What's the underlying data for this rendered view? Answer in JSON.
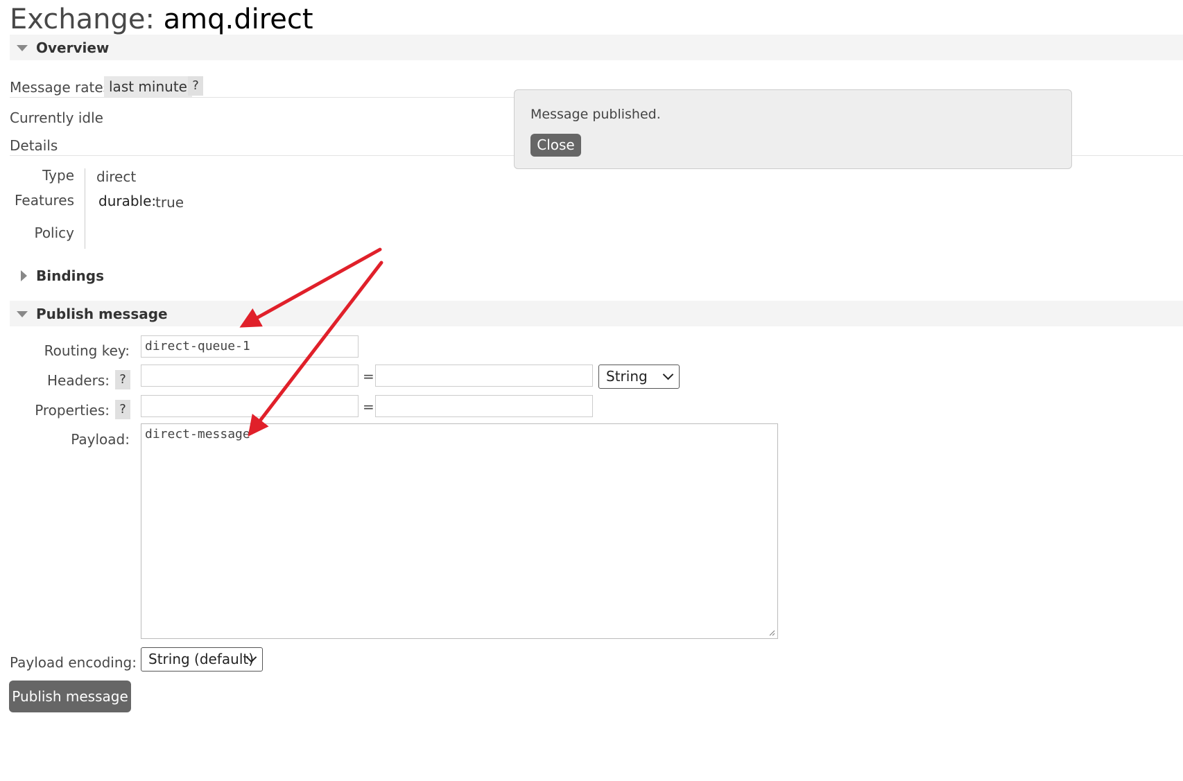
{
  "page": {
    "title_prefix": "Exchange: ",
    "title_name": "amq.direct"
  },
  "overview": {
    "header": "Overview",
    "message_rates_label": "Message rates",
    "rate_range": "last minute",
    "help": "?",
    "idle_text": "Currently idle",
    "details_label": "Details",
    "details": {
      "type_label": "Type",
      "type_value": "direct",
      "features_label": "Features",
      "features_key": "durable:",
      "features_value": "true",
      "policy_label": "Policy"
    }
  },
  "bindings": {
    "header": "Bindings"
  },
  "publish": {
    "header": "Publish message",
    "routing_key_label": "Routing key:",
    "routing_key_value": "direct-queue-1",
    "headers_label": "Headers:",
    "headers_help": "?",
    "headers_key": "",
    "headers_value": "",
    "equals": "=",
    "headers_type": "String",
    "properties_label": "Properties:",
    "properties_help": "?",
    "properties_key": "",
    "properties_value": "",
    "payload_label": "Payload:",
    "payload_value": "direct-message",
    "payload_encoding_label": "Payload encoding:",
    "payload_encoding_value": "String (default)",
    "submit_label": "Publish message"
  },
  "notification": {
    "message": "Message published.",
    "close_label": "Close"
  },
  "annotation": {
    "arrow_color": "#e0202a"
  }
}
